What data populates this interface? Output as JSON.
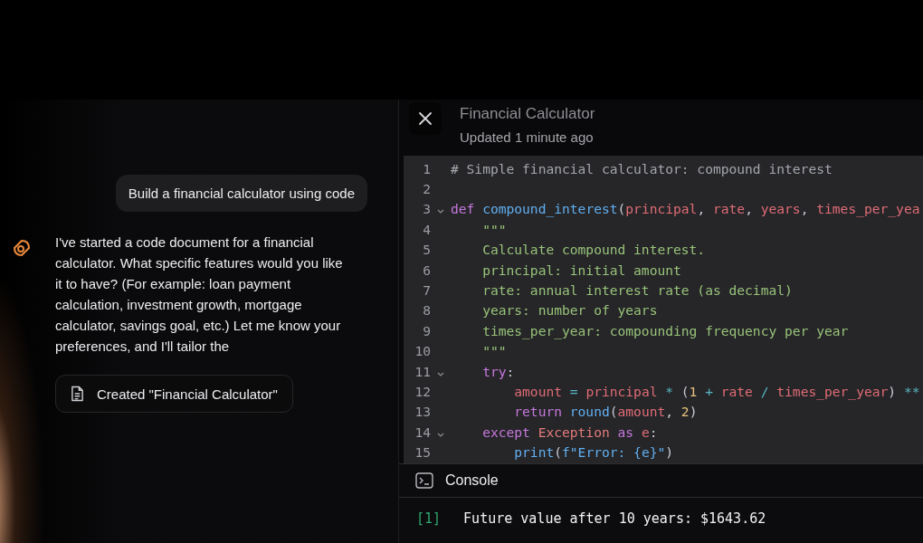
{
  "chat": {
    "user_message": "Build a financial calculator using code",
    "assistant_message": "I've started a code document for a financial calculator. What specific features would you like it to have? (For example: loan payment calculation, investment growth, mortgage calculator, savings goal, etc.) Let me know your preferences, and I'll tailor the",
    "artifact_chip": "Created \"Financial Calculator\""
  },
  "editor": {
    "title": "Financial Calculator",
    "subtitle": "Updated 1 minute ago",
    "lines": [
      {
        "number": "1",
        "foldable": false,
        "tokens": [
          {
            "kind": "comment",
            "text": "# Simple financial calculator: compound interest"
          }
        ]
      },
      {
        "number": "2",
        "foldable": false
      },
      {
        "number": "3",
        "foldable": true,
        "tokens": [
          {
            "kind": "keyword",
            "text": "def "
          },
          {
            "kind": "function",
            "text": "compound_interest"
          },
          {
            "kind": "punct",
            "text": "("
          },
          {
            "kind": "param",
            "text": "principal"
          },
          {
            "kind": "punct",
            "text": ", "
          },
          {
            "kind": "param",
            "text": "rate"
          },
          {
            "kind": "punct",
            "text": ", "
          },
          {
            "kind": "param",
            "text": "years"
          },
          {
            "kind": "punct",
            "text": ", "
          },
          {
            "kind": "param",
            "text": "times_per_yea"
          }
        ]
      },
      {
        "number": "4",
        "foldable": false,
        "tokens": [
          {
            "kind": "string",
            "text": "    \"\"\""
          }
        ]
      },
      {
        "number": "5",
        "foldable": false,
        "tokens": [
          {
            "kind": "string",
            "text": "    Calculate compound interest."
          }
        ]
      },
      {
        "number": "6",
        "foldable": false,
        "tokens": [
          {
            "kind": "string",
            "text": "    principal: initial amount"
          }
        ]
      },
      {
        "number": "7",
        "foldable": false,
        "tokens": [
          {
            "kind": "string",
            "text": "    rate: annual interest rate (as decimal)"
          }
        ]
      },
      {
        "number": "8",
        "foldable": false,
        "tokens": [
          {
            "kind": "string",
            "text": "    years: number of years"
          }
        ]
      },
      {
        "number": "9",
        "foldable": false,
        "tokens": [
          {
            "kind": "string",
            "text": "    times_per_year: compounding frequency per year"
          }
        ]
      },
      {
        "number": "10",
        "foldable": false,
        "tokens": [
          {
            "kind": "string",
            "text": "    \"\"\""
          }
        ]
      },
      {
        "number": "11",
        "foldable": true,
        "tokens": [
          {
            "kind": "keyword",
            "text": "    try"
          },
          {
            "kind": "punct",
            "text": ":"
          }
        ]
      },
      {
        "number": "12",
        "foldable": false,
        "tokens": [
          {
            "kind": "param",
            "text": "        amount"
          },
          {
            "kind": "operator",
            "text": " = "
          },
          {
            "kind": "param",
            "text": "principal"
          },
          {
            "kind": "operator",
            "text": " * "
          },
          {
            "kind": "punct",
            "text": "("
          },
          {
            "kind": "number",
            "text": "1"
          },
          {
            "kind": "operator",
            "text": " + "
          },
          {
            "kind": "param",
            "text": "rate"
          },
          {
            "kind": "operator",
            "text": " / "
          },
          {
            "kind": "param",
            "text": "times_per_year"
          },
          {
            "kind": "punct",
            "text": ") "
          },
          {
            "kind": "operator",
            "text": "**"
          }
        ]
      },
      {
        "number": "13",
        "foldable": false,
        "tokens": [
          {
            "kind": "keyword",
            "text": "        return "
          },
          {
            "kind": "function",
            "text": "round"
          },
          {
            "kind": "punct",
            "text": "("
          },
          {
            "kind": "param",
            "text": "amount"
          },
          {
            "kind": "punct",
            "text": ", "
          },
          {
            "kind": "number",
            "text": "2"
          },
          {
            "kind": "punct",
            "text": ")"
          }
        ]
      },
      {
        "number": "14",
        "foldable": true,
        "tokens": [
          {
            "kind": "keyword",
            "text": "    except "
          },
          {
            "kind": "class",
            "text": "Exception"
          },
          {
            "kind": "keyword",
            "text": " as "
          },
          {
            "kind": "param",
            "text": "e"
          },
          {
            "kind": "punct",
            "text": ":"
          }
        ]
      },
      {
        "number": "15",
        "foldable": false,
        "tokens": [
          {
            "kind": "function",
            "text": "        print"
          },
          {
            "kind": "punct",
            "text": "("
          },
          {
            "kind": "function",
            "text": "f\"Error: {e}\""
          },
          {
            "kind": "punct",
            "text": ")"
          }
        ]
      }
    ]
  },
  "console": {
    "title": "Console",
    "output": [
      {
        "prompt": "[1]",
        "text": "Future value after 10 years: $1643.62"
      }
    ]
  }
}
